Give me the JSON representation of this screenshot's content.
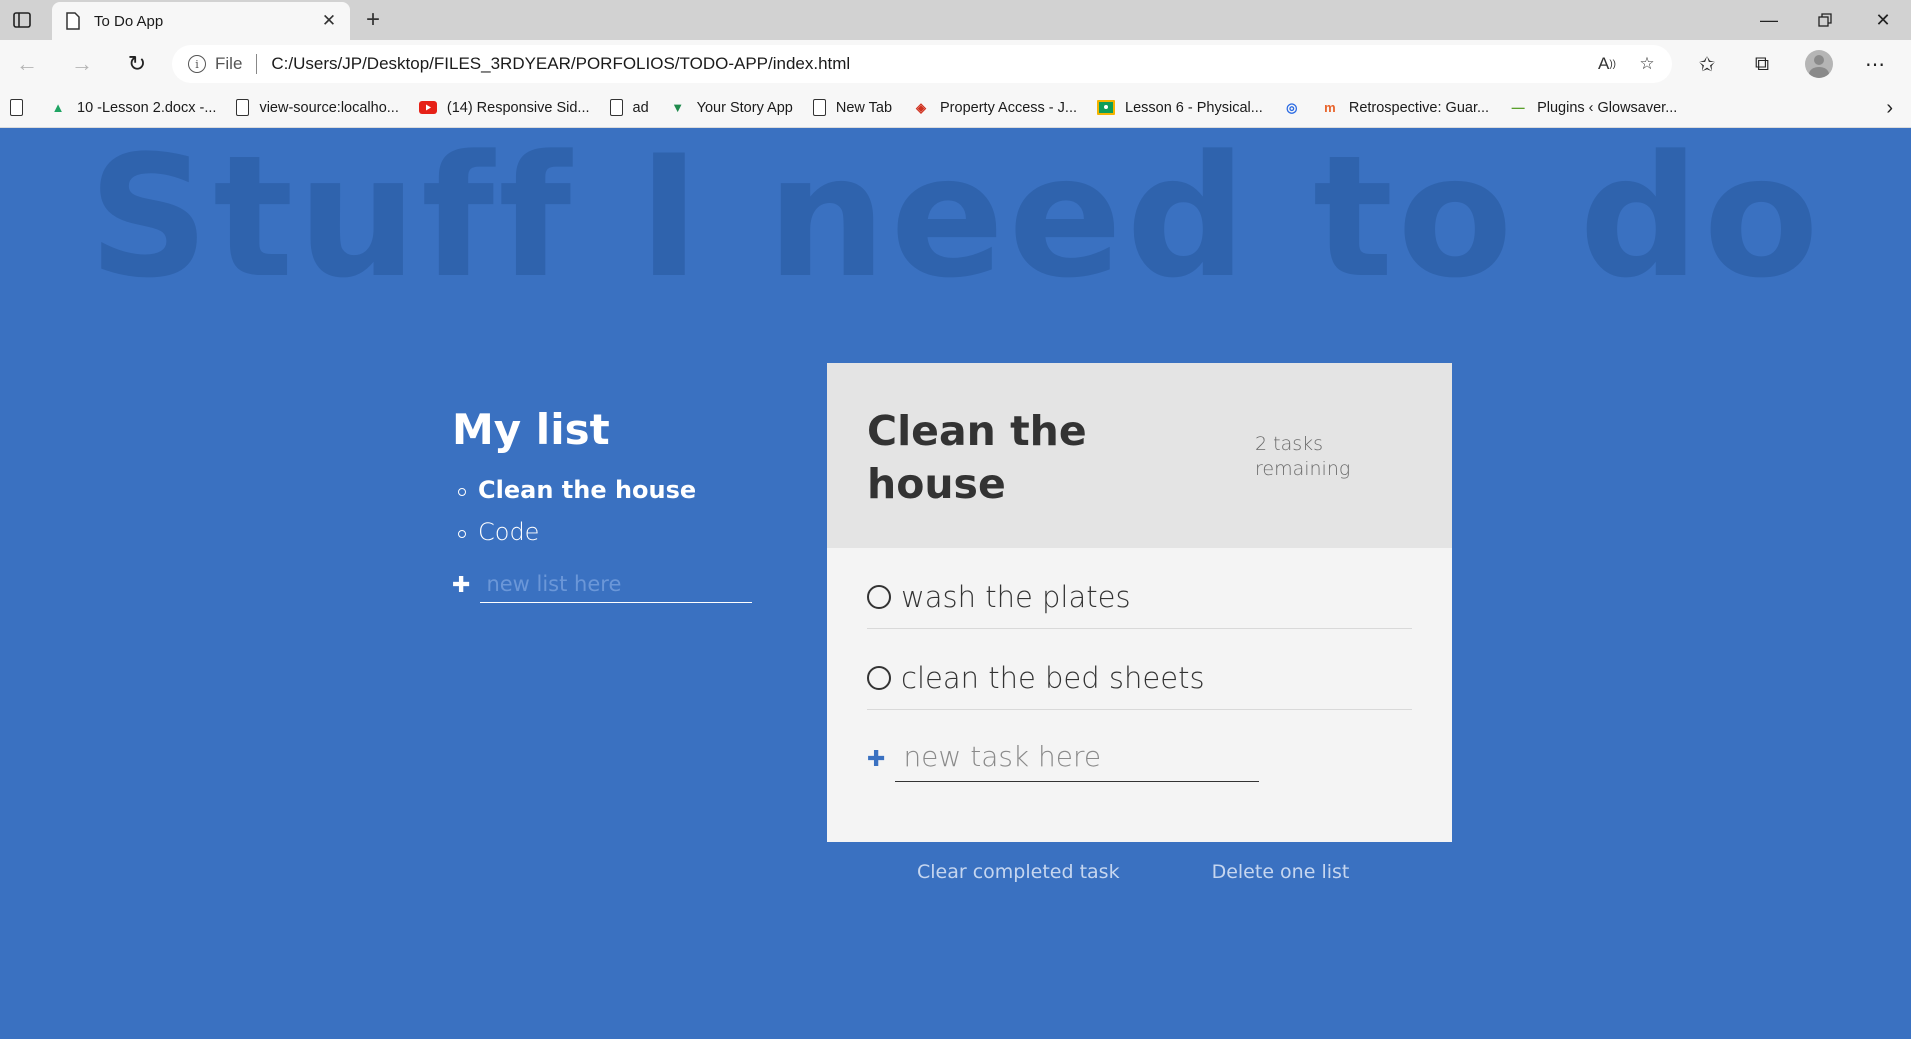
{
  "browser": {
    "tab": {
      "title": "To Do App"
    },
    "address": {
      "scheme": "File",
      "url": "C:/Users/JP/Desktop/FILES_3RDYEAR/PORFOLIOS/TODO-APP/index.html"
    },
    "bookmarks": [
      {
        "label": "10 -Lesson 2.docx -...",
        "icon": "google-drive-icon"
      },
      {
        "label": "view-source:localho...",
        "icon": "page-icon"
      },
      {
        "label": "(14) Responsive Sid...",
        "icon": "youtube-icon"
      },
      {
        "label": "ad",
        "icon": "page-icon"
      },
      {
        "label": "Your Story App",
        "icon": "vue-icon"
      },
      {
        "label": "New Tab",
        "icon": "page-icon"
      },
      {
        "label": "Property Access - J...",
        "icon": "site-icon"
      },
      {
        "label": "Lesson 6 - Physical...",
        "icon": "classroom-icon"
      },
      {
        "label": "Retrospective: Guar...",
        "icon": "site-icon"
      },
      {
        "label": "Plugins ‹ Glowsaver...",
        "icon": "site-icon"
      }
    ]
  },
  "page": {
    "title": "Stuff I need to do",
    "lists": {
      "heading": "My list",
      "items": [
        {
          "label": "Clean the house",
          "active": true
        },
        {
          "label": "Code",
          "active": false
        }
      ],
      "new_placeholder": "new list here"
    },
    "active_list": {
      "title": "Clean the house",
      "remaining": "2 tasks remaining",
      "tasks": [
        {
          "label": "wash the plates",
          "done": false
        },
        {
          "label": "clean the bed sheets",
          "done": false
        }
      ],
      "new_placeholder": "new task here"
    },
    "actions": {
      "clear_completed": "Clear completed task",
      "delete_list": "Delete one list"
    }
  },
  "colors": {
    "background": "#3a71c1",
    "title_watermark": "#2f63ad",
    "card": "#f4f4f4",
    "card_header": "#e4e4e4"
  }
}
